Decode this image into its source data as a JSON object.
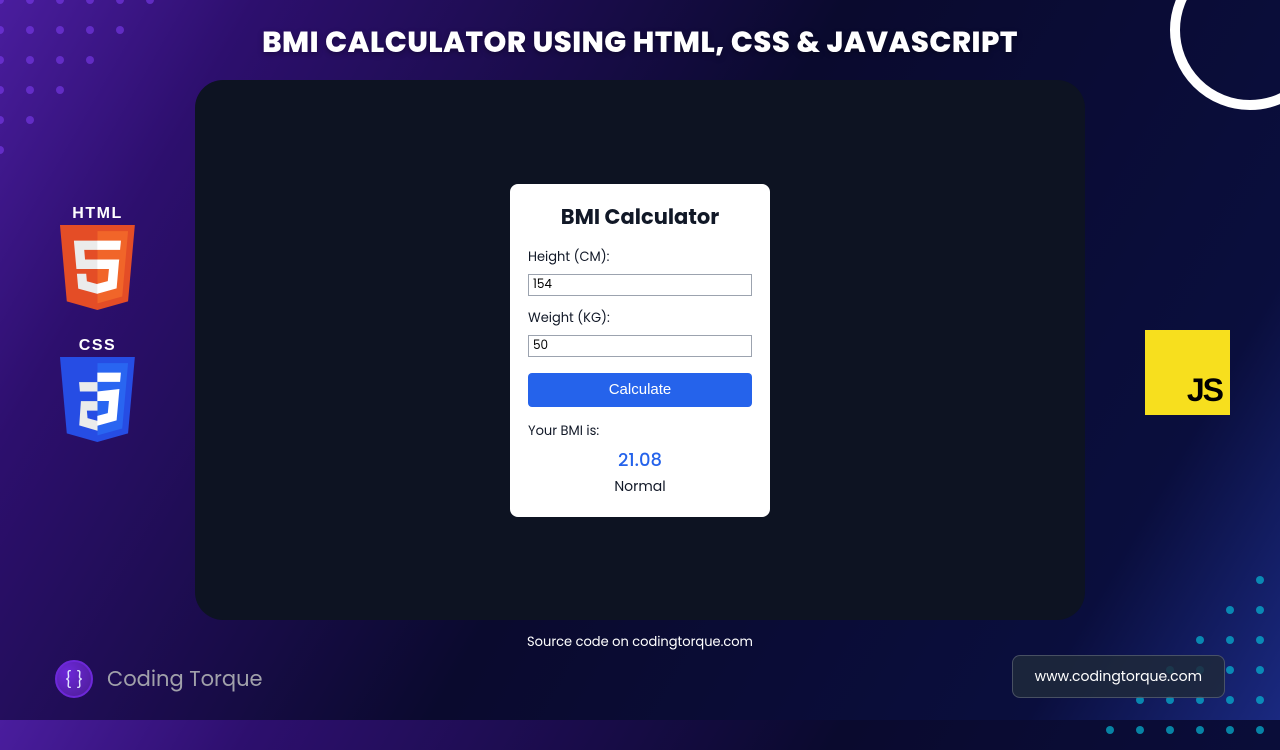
{
  "title": "BMI CALCULATOR USING HTML, CSS & JAVASCRIPT",
  "logos": {
    "html_label": "HTML",
    "css_label": "CSS",
    "js_label": "JS"
  },
  "calculator": {
    "heading": "BMI Calculator",
    "height_label": "Height (CM):",
    "height_value": "154",
    "weight_label": "Weight (KG):",
    "weight_value": "50",
    "button_label": "Calculate",
    "result_label": "Your BMI is:",
    "result_value": "21.08",
    "result_status": "Normal"
  },
  "footer": {
    "source_text": "Source code on codingtorque.com",
    "brand_name": "Coding Torque",
    "url": "www.codingtorque.com"
  },
  "colors": {
    "accent_blue": "#2563eb",
    "html_orange": "#e44d26",
    "css_blue": "#264de4",
    "js_yellow": "#f7df1e"
  }
}
